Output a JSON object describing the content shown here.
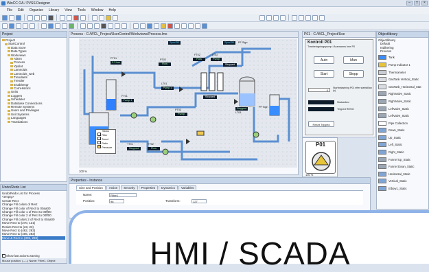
{
  "window": {
    "title": "WinCC OA / PVSS Designer"
  },
  "menu": [
    "File",
    "Edit",
    "Organize",
    "Library",
    "View",
    "Tools",
    "Window",
    "Help"
  ],
  "project_panel": {
    "title": "Project",
    "tree": [
      "Project",
      "StartControl",
      "Data Store",
      "Data Types",
      "Workviews",
      "Alarm",
      "Process",
      "Ypsilot",
      "Lamnoids",
      "Lamnoids_web",
      "Trendsets",
      "Trender",
      "Enablemgr",
      "CornHistoric",
      "Units",
      "Loggers",
      "Scheduler",
      "Database Connections",
      "Remote Systems",
      "Users and Privileges",
      "Unit Systems",
      "Languages",
      "Translations"
    ]
  },
  "script_panel": {
    "title": "Undo/Redo List",
    "subtitle": "Undo/Redo List for Process",
    "items": [
      "<empty>",
      "Create Rect",
      "Change Fill colors of Rect",
      "Change Fill color of Rect to 00aa00",
      "Change Fill color 1 of Rect to 00ff00",
      "Change Fill color 2 of Rect to 00ff00",
      "Change Fill colors 2 of Rect to 00aa00",
      "Move Rect to (270, 131)",
      "Resize Rect to (23, 23)",
      "Move Rect to (462, 283)",
      "Move Rect to (406, 283)",
      "Move & Rect to (306, 283)"
    ],
    "checkbox": "Show last actions warning",
    "status": "Mouse position: (--;--)    Name: Filter1, Object:"
  },
  "main_tab": {
    "label": "Process - C:/WCL_Project/UserControl/Workviews/Process.lmx"
  },
  "scada": {
    "tags": [
      {
        "id": "PT01",
        "val": "2.3 bar"
      },
      {
        "id": "FT01",
        "val": "Pump 1"
      },
      {
        "id": "LT01",
        "val": "Pump 1"
      },
      {
        "id": "PT02",
        "val": "Flow"
      },
      {
        "id": "FT02",
        "val": "Flow"
      },
      {
        "id": "LT02",
        "val": "Pump"
      },
      {
        "id": "PT03",
        "val": "Pump"
      },
      {
        "id": "LT03",
        "val": "Stopped"
      },
      {
        "id": "TT01",
        "val": "Stopped"
      },
      {
        "id": "TT02",
        "val": "Flow"
      }
    ],
    "tag_top1": "SyncDB",
    "tag_top2": "PF Sign",
    "tag_top3": "PF Sign",
    "stopped_labels": [
      "Stopped",
      "Stopped"
    ],
    "legend": {
      "title": "Sticks",
      "items": [
        "Filter",
        "Trend",
        "Ratio",
        "Pressure"
      ]
    },
    "status_bar": "100 %"
  },
  "hmi_panel": {
    "tab": "P01 - C:/WCL_Project/Use",
    "title": "Kontroll P01",
    "subtitle": "Tranbelagningspump i Assmanns Ime P0",
    "buttons": {
      "auto": "Auto",
      "man": "Man",
      "start": "Start",
      "stopp": "Stopp"
    },
    "field_val": "0",
    "field_label": "Startbelastning P01 efter startstillan (s)",
    "status1": "Status/bev",
    "status2": "Tripped RESO",
    "reset": "Reset Tripped",
    "pump_title": "P01",
    "zoom": "100 %"
  },
  "library": {
    "title": "Objectlibrary",
    "tree": [
      "Objectlibrary",
      "Default",
      "Indikering",
      "Process"
    ],
    "items": [
      "Tank",
      "Pump Indicator 1",
      "Thermometer",
      "GasTank Vertical_Static",
      "GasTank_Horizontal_Stat",
      "RightValve_Static",
      "RightValve_Static",
      "LeftValve_Static",
      "LeftValve_Static",
      "Pipe Collection",
      "Down_Static",
      "Up_Static",
      "Left_Static",
      "Right_Static",
      "Funnel Up_Static",
      "Funnel Down_Static",
      "Horizontal_Static",
      "Vertical_Static",
      "Elbow1_Static"
    ]
  },
  "properties": {
    "title": "Properties - Instance",
    "tabs": [
      "Size and Position",
      "Action",
      "Security",
      "Properties",
      "Dynamics",
      "Variables"
    ],
    "rows": [
      {
        "label": "Name:",
        "value": "Filter1"
      },
      {
        "label": "Position:",
        "value": "98"
      },
      {
        "label": "Transform:",
        "value": "127"
      }
    ]
  },
  "overlay": {
    "text": "HMI / SCADA"
  },
  "colors": {
    "accent": "#8fb3e8",
    "pipe": "#5b8fd1",
    "panel_head": "#c8d6ea"
  }
}
